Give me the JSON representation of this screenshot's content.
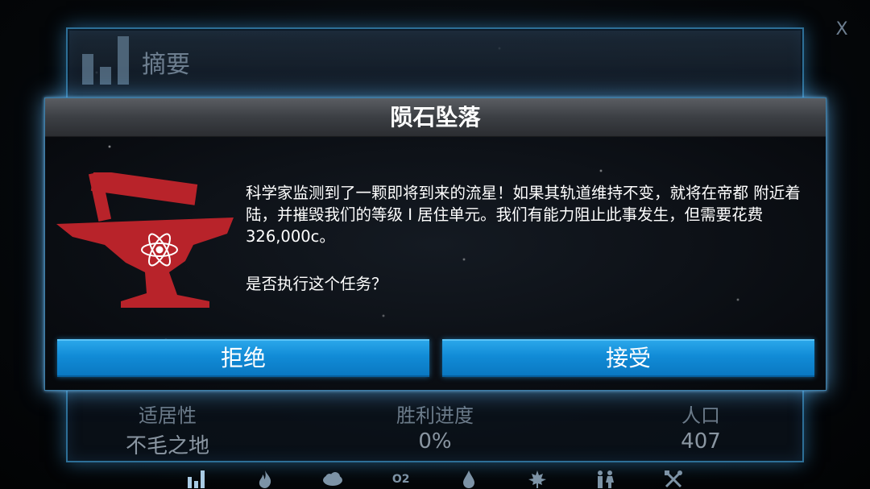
{
  "summary": {
    "title": "摘要",
    "close_label": "X",
    "stats": [
      {
        "label": "适居性",
        "value": "不毛之地"
      },
      {
        "label": "胜利进度",
        "value": "0%"
      },
      {
        "label": "人口",
        "value": "407"
      }
    ]
  },
  "bottom_tabs": [
    {
      "icon": "bar-chart-icon"
    },
    {
      "icon": "fire-icon"
    },
    {
      "icon": "cloud-icon"
    },
    {
      "icon": "oxygen-icon",
      "label": "O2"
    },
    {
      "icon": "water-drop-icon"
    },
    {
      "icon": "maple-leaf-icon"
    },
    {
      "icon": "people-icon"
    },
    {
      "icon": "tools-icon"
    }
  ],
  "dialog": {
    "title": "陨石坠落",
    "icon": "anvil-atom-icon",
    "body": "科学家监测到了一颗即将到来的流星！如果其轨道维持不变，就将在帝都 附近着陆，并摧毁我们的等级 I 居住单元。我们有能力阻止此事发生，但需要花费 326,000c。",
    "question": "是否执行这个任务？",
    "decline_label": "拒绝",
    "accept_label": "接受"
  },
  "colors": {
    "button_blue": "#118bd6",
    "icon_red": "#b8232a",
    "panel_border": "#2d6f97"
  }
}
